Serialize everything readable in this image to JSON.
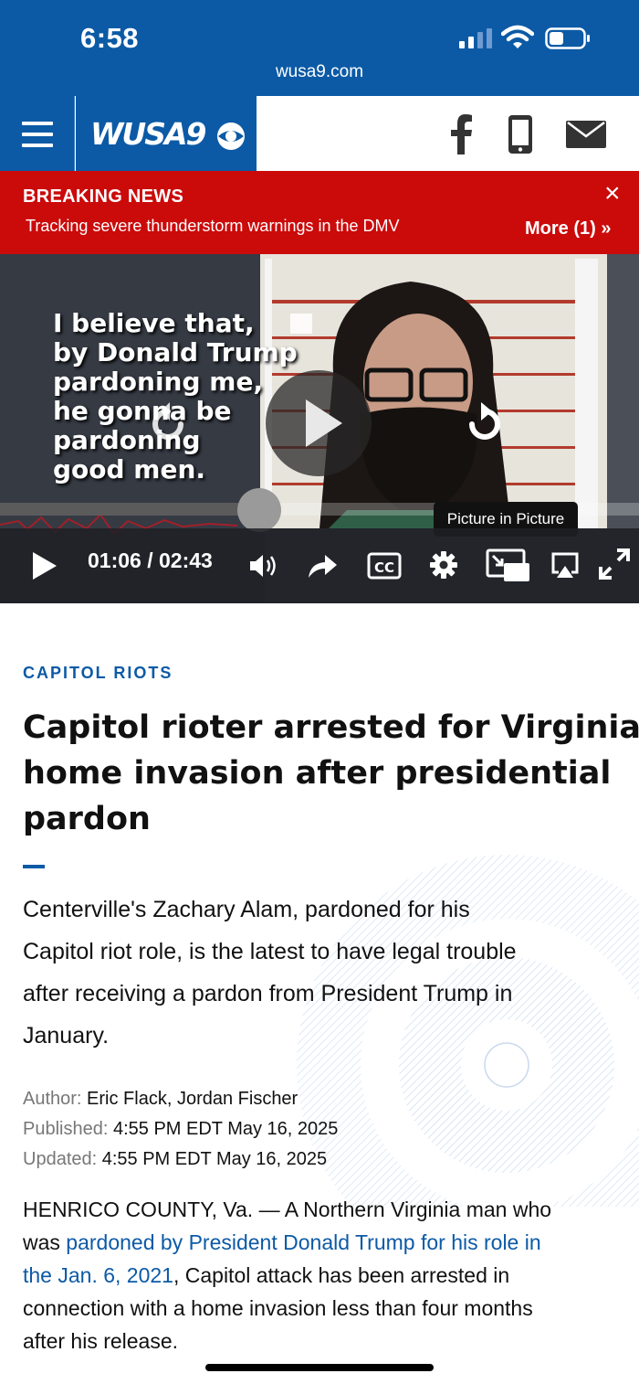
{
  "status_bar": {
    "time": "6:58",
    "url": "wusa9.com",
    "icons": [
      "signal-icon",
      "wifi-icon",
      "battery-icon"
    ]
  },
  "header": {
    "logo_text": "WUSA9",
    "icons": [
      "menu-icon",
      "facebook-icon",
      "phone-icon",
      "mail-icon"
    ],
    "brand_color": "#0c5aa6"
  },
  "breaking_news": {
    "title": "BREAKING NEWS",
    "text": "Tracking severe thunderstorm warnings in the DMV",
    "more": "More (1) »",
    "close": "×",
    "color": "#cb0a0a"
  },
  "video": {
    "caption_lines": [
      "I believe that,",
      "by Donald Trump",
      "pardoning me,",
      "he gonna be",
      "pardoning",
      "good men."
    ],
    "current_time": "01:06",
    "duration": "02:43",
    "time_readout": "01:06 / 02:43",
    "progress_fraction": 0.405,
    "tooltip": "Picture in Picture",
    "control_icons": [
      "play-icon",
      "volume-icon",
      "share-icon",
      "cc-icon",
      "settings-icon",
      "picture-in-picture-icon",
      "airplay-icon",
      "fullscreen-icon"
    ]
  },
  "article": {
    "category": "CAPITOL RIOTS",
    "headline_lines": [
      "Capitol rioter arrested for Virginia",
      "home invasion after presidential",
      "pardon"
    ],
    "summary_lines": [
      "Centerville's Zachary Alam, pardoned for his",
      "Capitol riot role, is the latest to have legal trouble",
      "after receiving a pardon from President Trump in",
      "January."
    ],
    "author_label": "Author:",
    "author": "Eric Flack, Jordan Fischer",
    "published_label": "Published:",
    "published": "4:55 PM EDT May 16, 2025",
    "updated_label": "Updated:",
    "updated": "4:55 PM EDT May 16, 2025",
    "body": {
      "line1": "HENRICO COUNTY, Va. — A Northern Virginia man who",
      "line2_prefix": "was ",
      "line2_link": "pardoned by President Donald Trump for his role in",
      "line3_link": "the Jan. 6, 2021",
      "line3_rest": ", Capitol attack has been arrested in",
      "line4": "connection with a home invasion less than four months",
      "line5": "after his release."
    }
  }
}
